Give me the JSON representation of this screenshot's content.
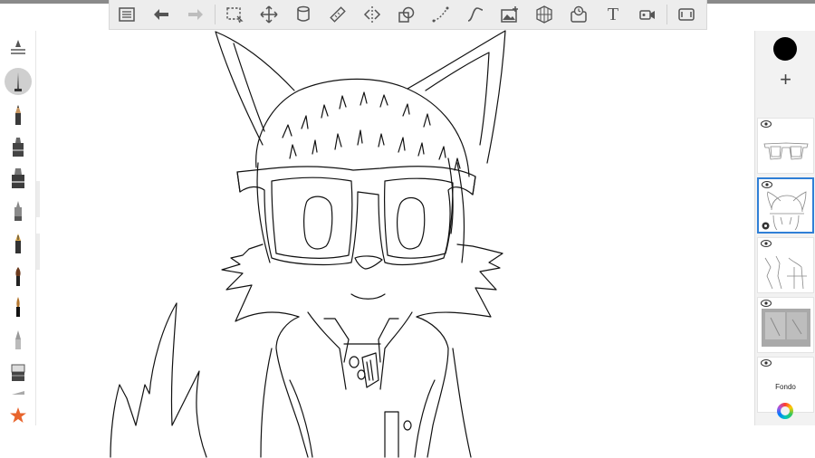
{
  "toolbar": {
    "buttons": [
      {
        "name": "layers-list-icon"
      },
      {
        "name": "undo-icon"
      },
      {
        "name": "redo-icon"
      },
      {
        "name": "selection-icon"
      },
      {
        "name": "transform-icon"
      },
      {
        "name": "fill-bucket-icon"
      },
      {
        "name": "ruler-icon"
      },
      {
        "name": "symmetry-icon"
      },
      {
        "name": "shape-icon"
      },
      {
        "name": "perspective-curve-icon"
      },
      {
        "name": "stroke-icon"
      },
      {
        "name": "add-image-icon"
      },
      {
        "name": "perspective-grid-icon"
      },
      {
        "name": "time-lapse-icon"
      },
      {
        "name": "text-icon",
        "label": "T"
      },
      {
        "name": "record-icon"
      },
      {
        "name": "fullscreen-icon"
      }
    ]
  },
  "brushes": [
    {
      "name": "brush-settings-icon"
    },
    {
      "name": "pencil-brush-icon",
      "active": true
    },
    {
      "name": "graphite-pencil-icon"
    },
    {
      "name": "marker-icon"
    },
    {
      "name": "chisel-marker-icon"
    },
    {
      "name": "airbrush-icon"
    },
    {
      "name": "fountain-pen-icon"
    },
    {
      "name": "paint-brush-icon"
    },
    {
      "name": "ink-brush-icon"
    },
    {
      "name": "smudge-icon"
    },
    {
      "name": "eraser-icon"
    },
    {
      "name": "favorite-star-icon"
    }
  ],
  "colors": {
    "current_color": "#000000",
    "selected_layer_border": "#2f7fd6"
  },
  "layers_panel": {
    "add_symbol": "+",
    "layers": [
      {
        "name": "layer-glasses"
      },
      {
        "name": "layer-head",
        "selected": true
      },
      {
        "name": "layer-body"
      },
      {
        "name": "layer-sketch-photo"
      },
      {
        "name": "layer-background",
        "label": "Fondo"
      }
    ]
  }
}
